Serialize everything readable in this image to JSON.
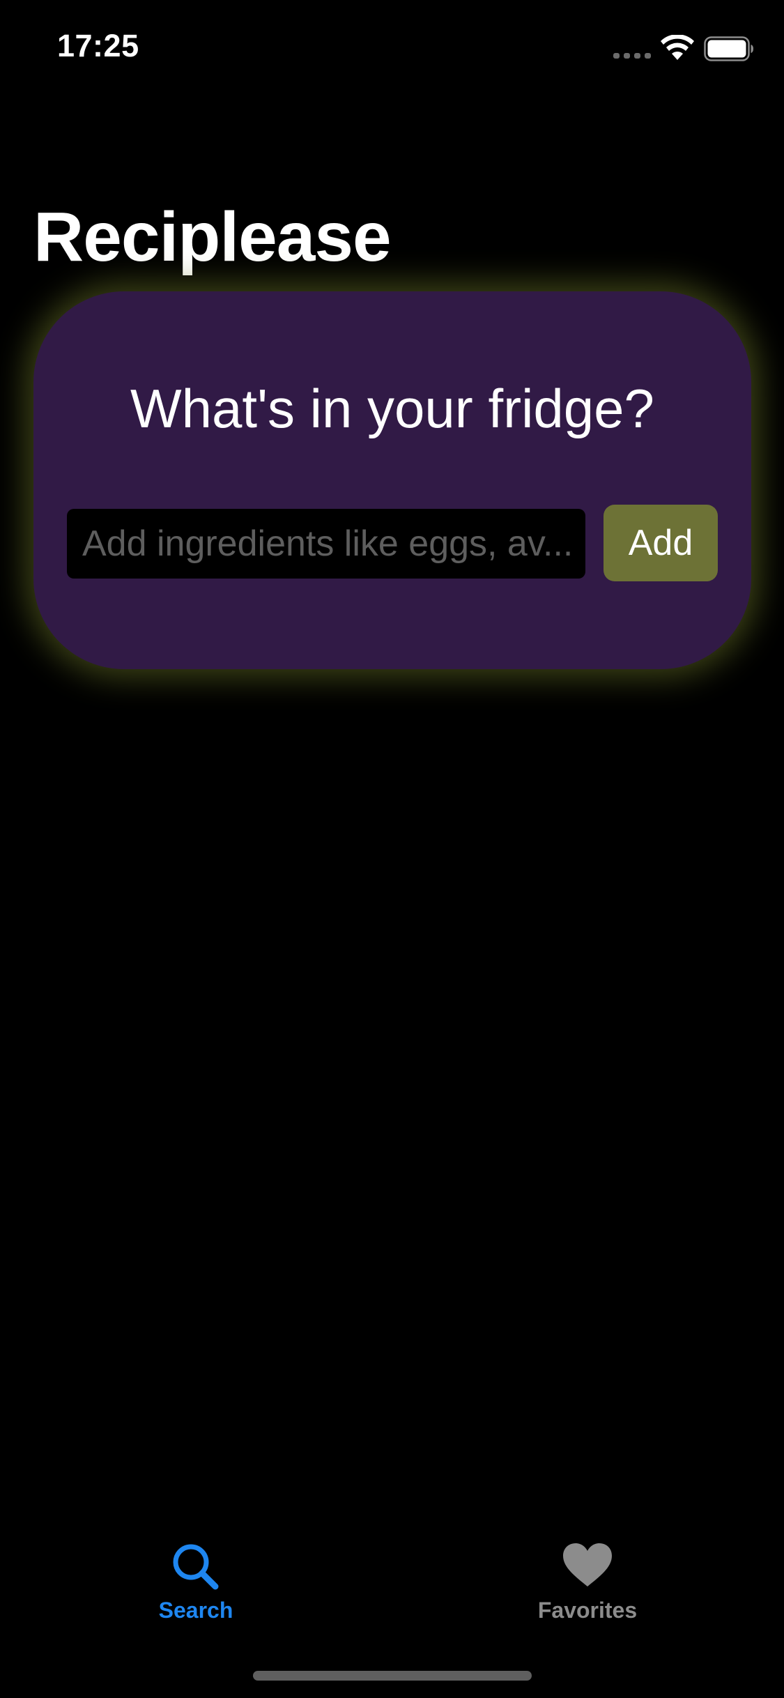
{
  "status_bar": {
    "time": "17:25",
    "icons": [
      "cellular-signal-icon",
      "wifi-icon",
      "battery-icon"
    ]
  },
  "header": {
    "title": "Reciplease"
  },
  "search_card": {
    "heading": "What's in your fridge?",
    "input": {
      "value": "",
      "placeholder": "Add ingredients like eggs, av..."
    },
    "add_button_label": "Add"
  },
  "tab_bar": {
    "tabs": [
      {
        "label": "Search",
        "icon": "search-icon",
        "selected": true
      },
      {
        "label": "Favorites",
        "icon": "heart-icon",
        "selected": false
      }
    ]
  },
  "colors": {
    "background": "#000000",
    "card": "#311a46",
    "card_glow": "#6e7828",
    "add_button": "#6d7236",
    "tab_active": "#1e86f0",
    "tab_inactive": "#8c8c8c"
  }
}
